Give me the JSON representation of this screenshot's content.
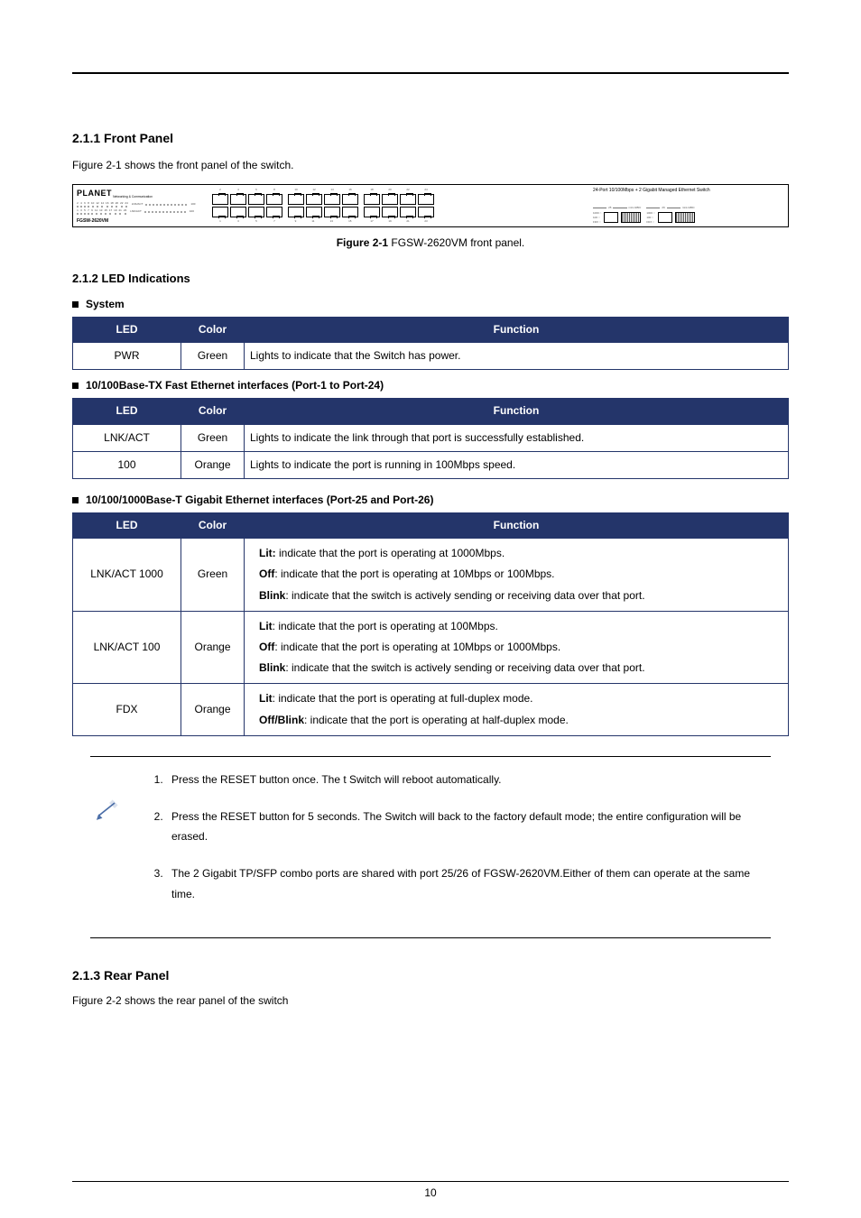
{
  "section_front": {
    "title": "2.1.1 Front Panel",
    "intro": "Figure 2-1 shows the front panel of the switch.",
    "caption_prefix": "Figure 2-1",
    "caption_text": "FGSW-2620VM front panel."
  },
  "device": {
    "brand": "PLANET",
    "brand_sub": "Networking & Communication",
    "model": "FGSW-2620VM",
    "led_group_1_right": "LNK/ACT",
    "led_group_1_right2": "100",
    "led_group_2_right": "LNK/ACT",
    "led_group_2_right2": "100",
    "reset_label": "RESET",
    "pwr_label": "PWR",
    "top_port_nums": [
      "2",
      "4",
      "6",
      "8",
      "10",
      "12",
      "14",
      "16",
      "18",
      "20",
      "22",
      "24"
    ],
    "bot_port_nums": [
      "1",
      "3",
      "5",
      "7",
      "9",
      "11",
      "13",
      "15",
      "17",
      "19",
      "21",
      "23"
    ],
    "led_nums_top": [
      "2",
      "4",
      "6",
      "8",
      "10",
      "12",
      "14",
      "16",
      "18",
      "20",
      "22",
      "24"
    ],
    "led_nums_bot": [
      "1",
      "3",
      "5",
      "7",
      "9",
      "11",
      "13",
      "15",
      "17",
      "19",
      "21",
      "23"
    ],
    "right_desc": "24-Port 10/100Mbps + 2 Gigabit Managed Ethernet Switch",
    "sfp": {
      "g25": {
        "num": "25",
        "mini": "mini-GBIC",
        "l1": "1000",
        "l2": "100",
        "l3": "FDX"
      },
      "g26": {
        "num": "26",
        "mini": "mini-GBIC",
        "l1": "1000",
        "l2": "100",
        "l3": "FDX"
      }
    }
  },
  "led_section": {
    "title": "2.1.2 LED Indications",
    "bullets": {
      "system": "System",
      "fe": "10/100Base-TX Fast Ethernet interfaces (Port-1 to Port-24)",
      "ge": "10/100/1000Base-T Gigabit Ethernet interfaces (Port-25 and Port-26)"
    },
    "headers": {
      "led": "LED",
      "color": "Color",
      "func": "Function"
    },
    "tbl_system": [
      {
        "led": "PWR",
        "color": "Green",
        "func": "Lights to indicate that the Switch has power."
      }
    ],
    "tbl_fe": [
      {
        "led": "LNK/ACT",
        "color": "Green",
        "func": "Lights to indicate the link through that port is successfully established."
      },
      {
        "led": "100",
        "color": "Orange",
        "func": "Lights to indicate the port is running in 100Mbps speed."
      }
    ],
    "tbl_ge": [
      {
        "led": "LNK/ACT 1000",
        "color": "Green",
        "func": [
          {
            "p": "Lit:",
            "t": " indicate that the port is operating at 1000Mbps."
          },
          {
            "p": "Off",
            "t": ": indicate that the port is operating at 10Mbps or 100Mbps."
          },
          {
            "p": "Blink",
            "t": ": indicate that the switch is actively sending or receiving data over that port."
          }
        ]
      },
      {
        "led": "LNK/ACT 100",
        "color": "Orange",
        "func": [
          {
            "p": "Lit",
            "t": ": indicate that the port is operating at 100Mbps."
          },
          {
            "p": "Off",
            "t": ": indicate that the port is operating at 10Mbps or 1000Mbps."
          },
          {
            "p": "Blink",
            "t": ": indicate that the switch is actively sending or receiving data over that port."
          }
        ]
      },
      {
        "led": "FDX",
        "color": "Orange",
        "func": [
          {
            "p": "Lit",
            "t": ": indicate that the port is operating at full-duplex mode."
          },
          {
            "p": "Off/Blink",
            "t": ": indicate that the port is operating at half-duplex mode."
          }
        ]
      }
    ]
  },
  "notice": {
    "label": "Notice:",
    "items": [
      "Press the RESET button once. The t Switch will reboot automatically.",
      "Press the RESET button for 5 seconds. The Switch will back to the factory default mode; the entire configuration will be erased.",
      "The 2 Gigabit TP/SFP combo ports are shared with port 25/26 of FGSW-2620VM.Either of them can operate at the same time."
    ]
  },
  "section_rear": {
    "title": "2.1.3 Rear Panel",
    "intro": "Figure 2-2 shows the rear panel of the switch"
  },
  "page_num": "10"
}
